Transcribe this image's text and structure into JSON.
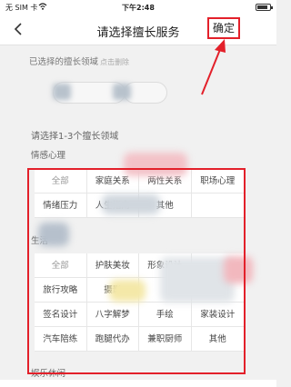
{
  "status_bar": {
    "carrier": "无 SIM 卡",
    "wifi_icon": "wifi-icon",
    "time": "下午2:48",
    "battery_pct": "",
    "battery_level": 0.85
  },
  "header": {
    "back_icon": "chevron-left-icon",
    "title": "请选择擅长服务",
    "confirm_label": "确定",
    "accent_color": "#e3202a"
  },
  "selected": {
    "label": "已选择的擅长领域",
    "hint": "点击删除",
    "chips": [
      "",
      ""
    ]
  },
  "instruction": "请选择1-3个擅长领域",
  "sections": [
    {
      "title": "情感心理",
      "items": [
        "全部",
        "家庭关系",
        "两性关系",
        "职场心理",
        "情绪压力",
        "人生指南",
        "其他",
        ""
      ]
    },
    {
      "title": "生活",
      "items": [
        "全部",
        "护肤美妆",
        "形象设计",
        "",
        "旅行攻略",
        "摄影",
        "",
        "",
        "签名设计",
        "八字解梦",
        "手绘",
        "家装设计",
        "汽车陪练",
        "跑腿代办",
        "兼职厨师",
        "其他"
      ]
    },
    {
      "title": "娱乐休闲",
      "items": []
    }
  ]
}
